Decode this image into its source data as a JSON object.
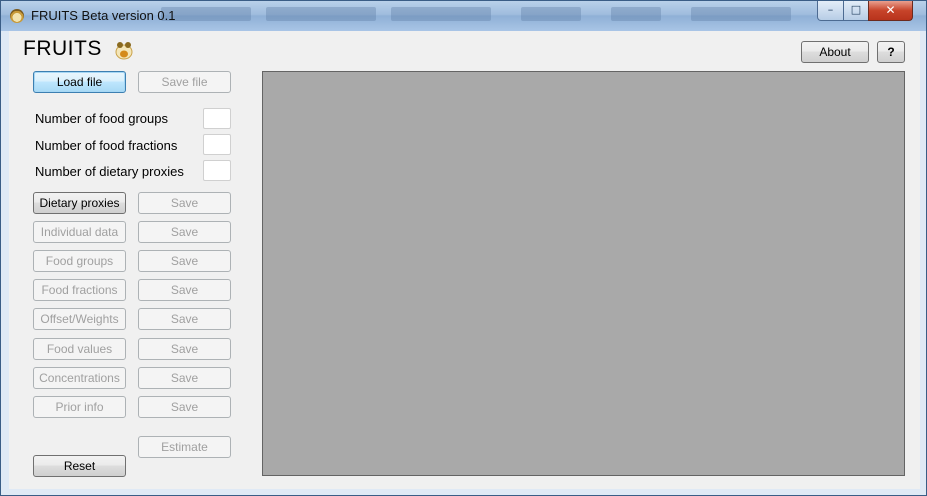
{
  "window": {
    "title": "FRUITS Beta version 0.1",
    "controls": {
      "minimize": "–",
      "maximize": "□",
      "close": "✕"
    }
  },
  "header": {
    "app_name": "FRUITS",
    "about_label": "About",
    "help_label": "?"
  },
  "file": {
    "load_label": "Load file",
    "save_label": "Save file"
  },
  "counts": {
    "food_groups_label": "Number of food groups",
    "food_groups_value": "",
    "food_fractions_label": "Number of food fractions",
    "food_fractions_value": "",
    "dietary_proxies_label": "Number of dietary proxies",
    "dietary_proxies_value": ""
  },
  "data_rows": [
    {
      "label": "Dietary proxies",
      "save": "Save",
      "enabled": true
    },
    {
      "label": "Individual data",
      "save": "Save",
      "enabled": false
    },
    {
      "label": "Food groups",
      "save": "Save",
      "enabled": false
    },
    {
      "label": "Food fractions",
      "save": "Save",
      "enabled": false
    },
    {
      "label": "Offset/Weights",
      "save": "Save",
      "enabled": false
    },
    {
      "label": "Food values",
      "save": "Save",
      "enabled": false
    },
    {
      "label": "Concentrations",
      "save": "Save",
      "enabled": false
    },
    {
      "label": "Prior info",
      "save": "Save",
      "enabled": false
    }
  ],
  "actions": {
    "estimate_label": "Estimate",
    "reset_label": "Reset"
  },
  "colors": {
    "canvas": "#a9a9a9",
    "disabled_text": "#a0a0a0",
    "focus_border": "#3c7fb1"
  }
}
